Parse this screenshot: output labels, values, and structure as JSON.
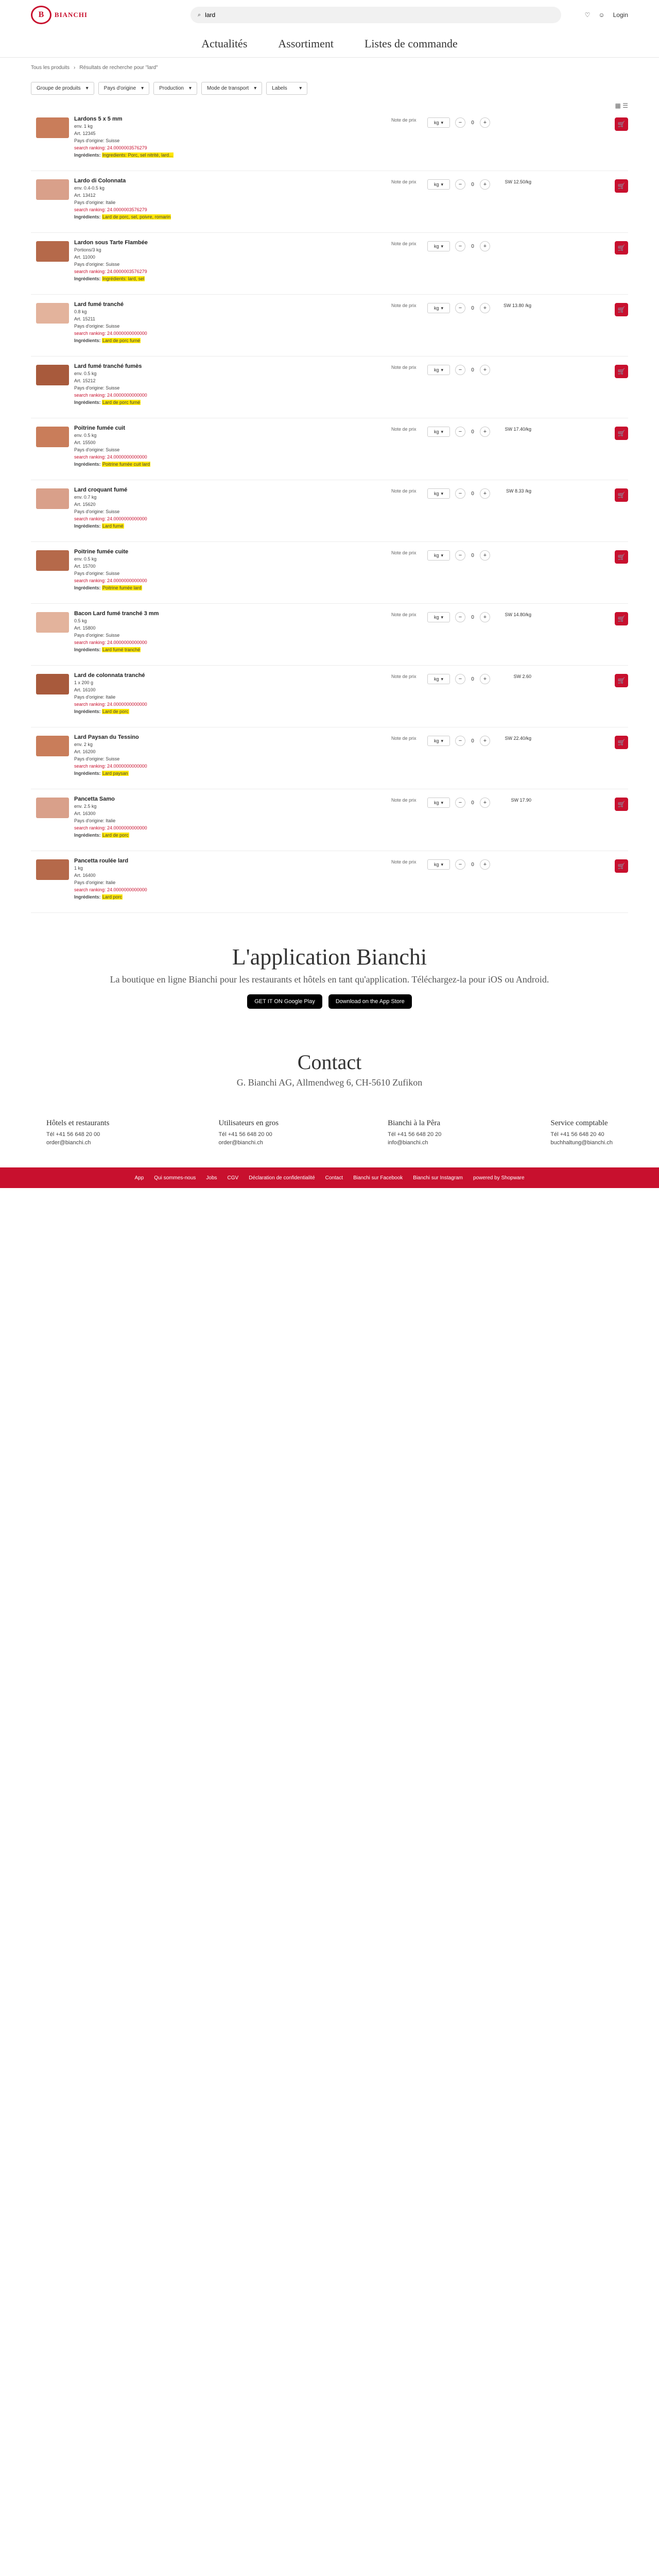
{
  "header": {
    "logo_text": "BIANCHI",
    "search_value": "lard",
    "search_placeholder": "Rechercher",
    "login_label": "Login"
  },
  "nav": [
    "Actualités",
    "Assortiment",
    "Listes de commande"
  ],
  "breadcrumb": [
    "Tous les produits",
    "Résultats de recherche pour \"lard\""
  ],
  "filters": [
    "Groupe de produits",
    "Pays d'origine",
    "Production",
    "Mode de transport",
    "Labels"
  ],
  "products": [
    {
      "name": "Lardons 5 x 5 mm",
      "weight": "env. 1 kg",
      "art": "Art. 12345",
      "origin": "Pays d'origine: Suisse",
      "match": "search ranking: 24.0000003576279",
      "detail": "Ingredients: Porc, sel nitrité, lard...",
      "price": "",
      "highlight": "lard"
    },
    {
      "name": "Lardo di Colonnata",
      "weight": "env. 0.4-0.5 kg",
      "art": "Art. 13412",
      "origin": "Pays d'origine: Italie",
      "match": "search ranking: 24.0000003576279",
      "detail": "Lard de porc, sel, poivre, romarin",
      "price": "SW 12.50/kg"
    },
    {
      "name": "Lardon sous Tarte Flambée",
      "weight": "Portions/3 kg",
      "art": "Art. 11000",
      "origin": "Pays d'origine: Suisse",
      "match": "search ranking: 24.0000003576279",
      "detail": "Ingrédients: lard, sel",
      "price": ""
    },
    {
      "name": "Lard fumé tranché",
      "weight": "0.8 kg",
      "art": "Art. 15211",
      "origin": "Pays d'origine: Suisse",
      "match": "search ranking: 24.0000000000000",
      "detail": "Lard de porc fumé",
      "price": "SW 13.80 /kg"
    },
    {
      "name": "Lard fumé tranché fumès",
      "weight": "env. 0.5 kg",
      "art": "Art. 15212",
      "origin": "Pays d'origine: Suisse",
      "match": "search ranking: 24.0000000000000",
      "detail": "Lard de porc fumé",
      "price": ""
    },
    {
      "name": "Poitrine fumée cuit",
      "weight": "env. 0.5 kg",
      "art": "Art. 15500",
      "origin": "Pays d'origine: Suisse",
      "match": "search ranking: 24.0000000000000",
      "detail": "Poitrine fumée cuit lard",
      "price": "SW 17.40/kg"
    },
    {
      "name": "Lard croquant fumé",
      "weight": "env. 0.7 kg",
      "art": "Art. 15620",
      "origin": "Pays d'origine: Suisse",
      "match": "search ranking: 24.0000000000000",
      "detail": "Lard fumé",
      "price": "SW 8.33 /kg"
    },
    {
      "name": "Poitrine fumée cuite",
      "weight": "env. 0.5 kg",
      "art": "Art. 15700",
      "origin": "Pays d'origine: Suisse",
      "match": "search ranking: 24.0000000000000",
      "detail": "Poitrine fumée lard",
      "price": ""
    },
    {
      "name": "Bacon Lard fumé tranché 3 mm",
      "weight": "0.5 kg",
      "art": "Art. 15800",
      "origin": "Pays d'origine: Suisse",
      "match": "search ranking: 24.0000000000000",
      "detail": "Lard fumé tranché",
      "price": "SW 14.80/kg"
    },
    {
      "name": "Lard de colonnata tranché",
      "weight": "1 x 200 g",
      "art": "Art. 16100",
      "origin": "Pays d'origine: Italie",
      "match": "search ranking: 24.0000000000000",
      "detail": "Lard de porc",
      "price": "SW 2.60"
    },
    {
      "name": "Lard Paysan du Tessino",
      "weight": "env. 2 kg",
      "art": "Art. 16200",
      "origin": "Pays d'origine: Suisse",
      "match": "search ranking: 24.0000000000000",
      "detail": "Lard paysan",
      "price": "SW 22.40/kg"
    },
    {
      "name": "Pancetta Samo",
      "weight": "env. 2.5 kg",
      "art": "Art. 16300",
      "origin": "Pays d'origine: Italie",
      "match": "search ranking: 24.0000000000000",
      "detail": "Lard de porc",
      "price": "SW 17.90"
    },
    {
      "name": "Pancetta roulée lard",
      "weight": "1 kg",
      "art": "Art. 16400",
      "origin": "Pays d'origine: Italie",
      "match": "search ranking: 24.0000000000000",
      "detail": "Lard porc",
      "price": ""
    }
  ],
  "labels": {
    "list_link": "Note de prix",
    "unit": "kg",
    "qty": "0",
    "minus": "−",
    "plus": "+",
    "ingredients_label": "Ingrédients:",
    "cart_icon": "cart-icon"
  },
  "app": {
    "title": "L'application Bianchi",
    "text": "La boutique en ligne Bianchi pour les restaurants et hôtels en tant qu'application. Téléchargez-la pour iOS ou Android.",
    "google": "GET IT ON Google Play",
    "apple": "Download on the App Store"
  },
  "contact": {
    "title": "Contact",
    "address": "G. Bianchi AG, Allmendweg 6, CH-5610 Zufikon",
    "cols": [
      {
        "title": "Hôtels et restaurants",
        "lines": [
          "Tél +41 56 648 20 00",
          "order@bianchi.ch"
        ]
      },
      {
        "title": "Utilisateurs en gros",
        "lines": [
          "Tél +41 56 648 20 00",
          "order@bianchi.ch"
        ]
      },
      {
        "title": "Bianchi à la Pêra",
        "lines": [
          "Tél +41 56 648 20 20",
          "info@bianchi.ch"
        ]
      },
      {
        "title": "Service comptable",
        "lines": [
          "Tél +41 56 648 20 40",
          "buchhaltung@bianchi.ch"
        ]
      }
    ]
  },
  "footer": [
    "App",
    "Qui sommes-nous",
    "Jobs",
    "CGV",
    "Déclaration de confidentialité",
    "Contact",
    "Bianchi sur Facebook",
    "Bianchi sur Instagram",
    "powered by Shopware"
  ]
}
